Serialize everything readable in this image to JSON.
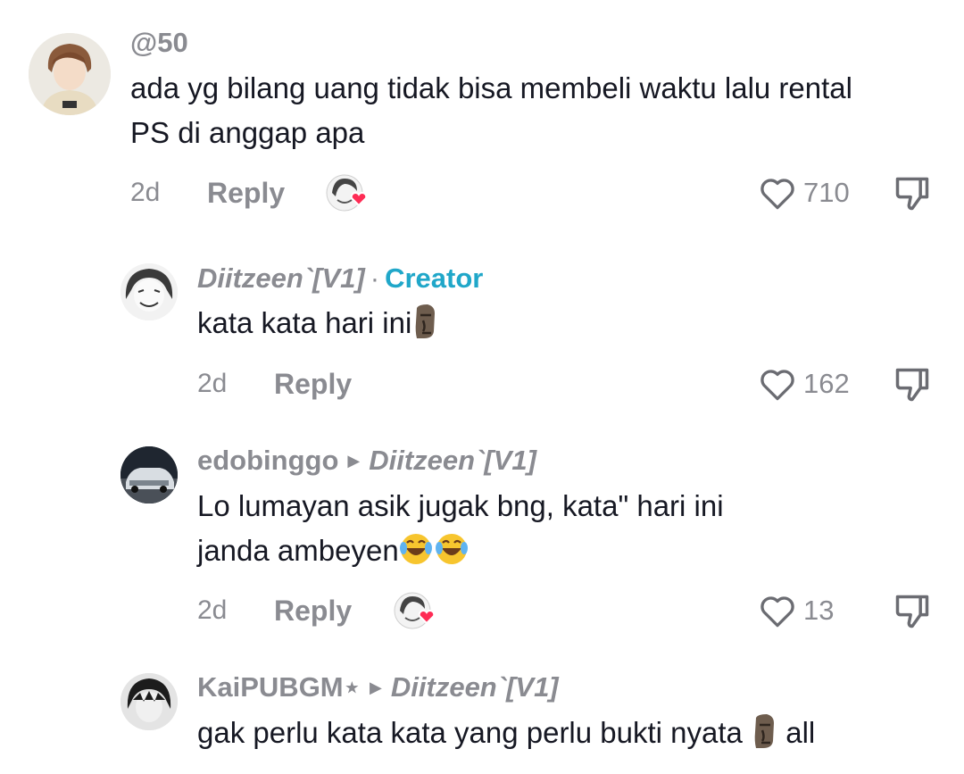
{
  "comments": [
    {
      "username": "@50",
      "text_line1": "ada yg bilang uang tidak bisa membeli waktu lalu rental",
      "text_line2": "PS di anggap apa",
      "time": "2d",
      "reply": "Reply",
      "likes": "710",
      "liked_by_creator": true
    },
    {
      "username": "Diitzeen`[V1]",
      "separator": "·",
      "badge": "Creator",
      "text_line1": "kata kata hari ini",
      "emoji": "moai",
      "time": "2d",
      "reply": "Reply",
      "likes": "162"
    },
    {
      "username": "edobinggo",
      "reply_to": "Diitzeen`[V1]",
      "text_line1": "Lo lumayan asik jugak bng, kata\" hari ini",
      "text_line2": "janda ambeyen",
      "emoji": "face-with-tears-of-joy x2",
      "time": "2d",
      "reply": "Reply",
      "likes": "13",
      "liked_by_creator": true
    },
    {
      "username": "KaiPUBGM⋆",
      "reply_to": "Diitzeen`[V1]",
      "text_part1": "gak perlu kata kata yang perlu bukti nyata",
      "emoji": "moai",
      "text_part2": "all"
    }
  ],
  "icons": {
    "like": "heart-outline-icon",
    "dislike": "thumbs-down-outline-icon",
    "liked_by_creator": "creator-heart-icon"
  },
  "colors": {
    "creator_badge": "#20a7c9",
    "secondary_text": "#8a8b91",
    "primary_text": "#161823",
    "heart": "#fe2c55"
  }
}
